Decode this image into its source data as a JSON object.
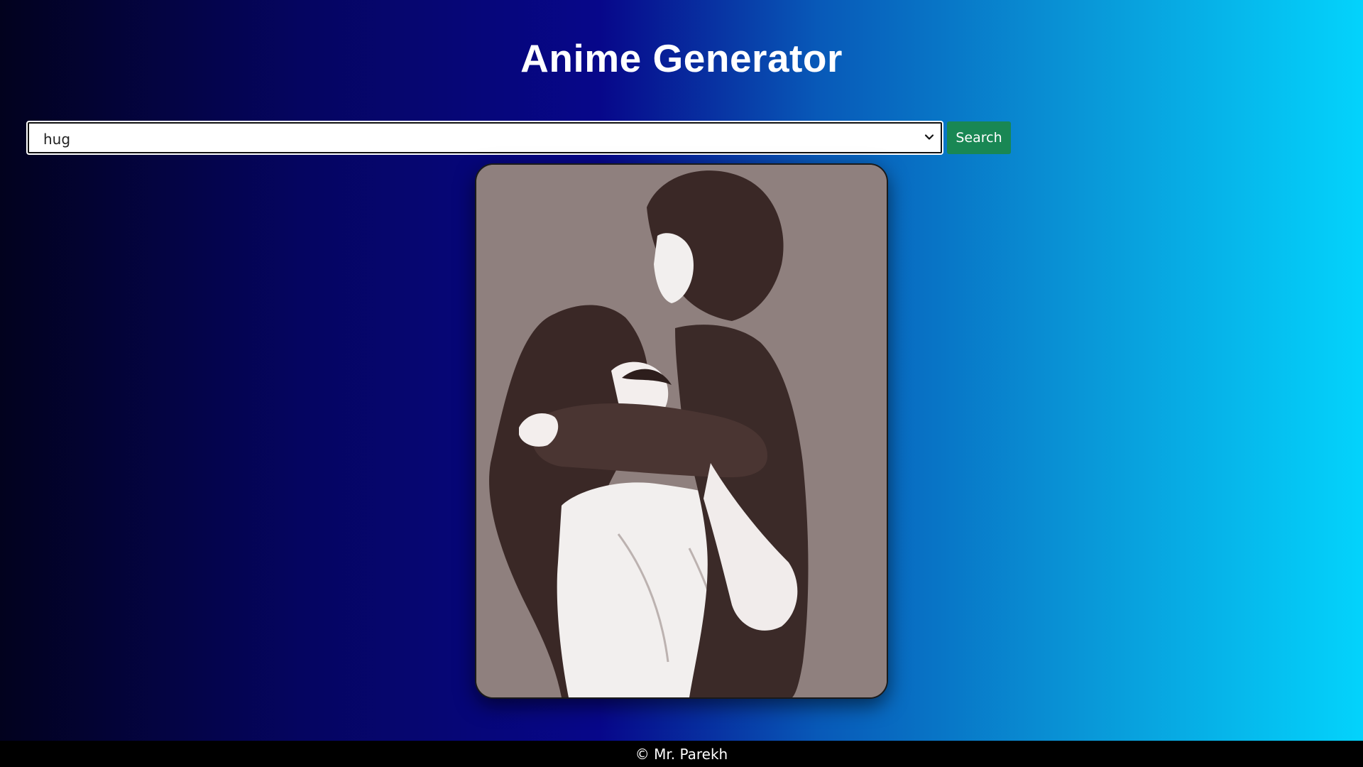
{
  "header": {
    "title": "Anime Generator"
  },
  "search": {
    "selected_value": "hug",
    "button_label": "Search"
  },
  "result": {
    "image_subject": "anime-couple-hug-illustration"
  },
  "footer": {
    "text": "© Mr. Parekh"
  },
  "colors": {
    "button": "#198754",
    "footer_bg": "#000000",
    "image_bg": "#8f807e",
    "gradient_left": "#02021e",
    "gradient_right": "#03d3fc"
  }
}
